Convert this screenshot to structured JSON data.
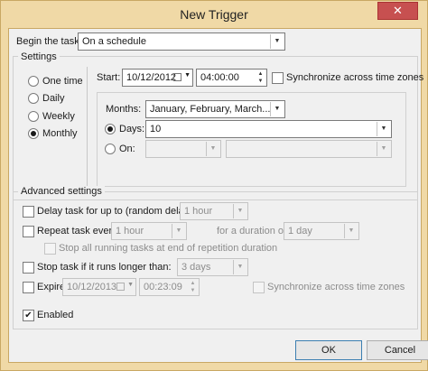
{
  "window": {
    "title": "New Trigger",
    "close_glyph": "✕"
  },
  "begin": {
    "label": "Begin the task:",
    "value": "On a schedule"
  },
  "settings": {
    "label": "Settings",
    "options": [
      "One time",
      "Daily",
      "Weekly",
      "Monthly"
    ],
    "selected": "Monthly",
    "start_label": "Start:",
    "start_date": "10/12/2012",
    "start_time": "04:00:00",
    "sync_label": "Synchronize across time zones",
    "months_label": "Months:",
    "months_value": "January, February, March...",
    "days_label": "Days:",
    "days_value": "10",
    "on_label": "On:"
  },
  "advanced": {
    "label": "Advanced settings",
    "delay_label": "Delay task for up to (random delay):",
    "delay_value": "1 hour",
    "repeat_label": "Repeat task every:",
    "repeat_value": "1 hour",
    "duration_label": "for a duration of:",
    "duration_value": "1 day",
    "stop_running_label": "Stop all running tasks at end of repetition duration",
    "stop_longer_label": "Stop task if it runs longer than:",
    "stop_longer_value": "3 days",
    "expire_label": "Expire:",
    "expire_date": "10/12/2013",
    "expire_time": "00:23:09",
    "expire_sync_label": "Synchronize across time zones",
    "enabled_label": "Enabled",
    "enabled_mark": "✔"
  },
  "buttons": {
    "ok": "OK",
    "cancel": "Cancel"
  },
  "colors": {
    "frame": "#f0d9a6",
    "close": "#c75050",
    "client": "#f0f0f0"
  }
}
